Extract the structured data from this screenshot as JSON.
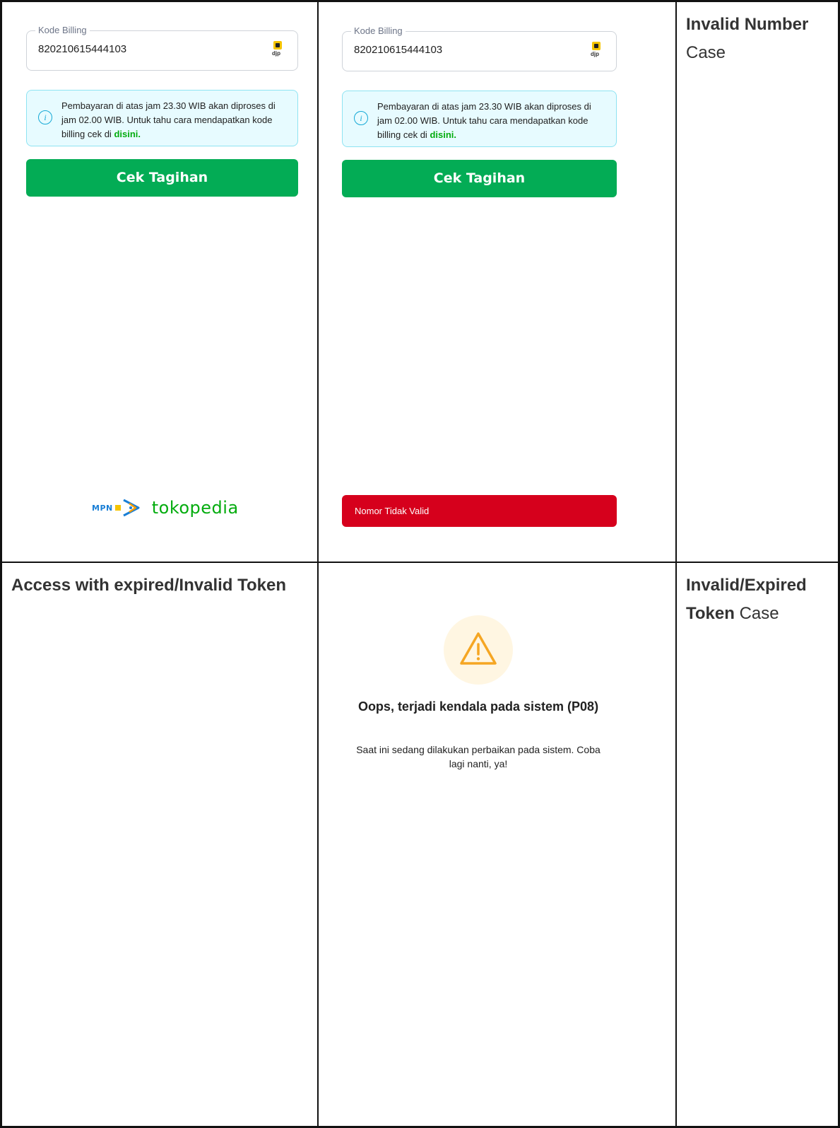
{
  "row1": {
    "screen_a": {
      "field_label": "Kode Billing",
      "field_value": "820210615444103",
      "djp_label": "djp",
      "info_text": "Pembayaran di atas jam 23.30 WIB akan diproses di jam 02.00 WIB. Untuk tahu cara mendapatkan kode billing cek di",
      "info_link": "disini",
      "info_period": ".",
      "button_label": "Cek Tagihan",
      "logo_mpn": "MPN",
      "logo_tokopedia": "tokopedia"
    },
    "screen_b": {
      "field_label": "Kode Billing",
      "field_value": "820210615444103",
      "djp_label": "djp",
      "info_text": "Pembayaran di atas jam 23.30 WIB akan diproses di jam 02.00 WIB. Untuk tahu cara mendapatkan kode billing cek di",
      "info_link": "disini",
      "info_period": ".",
      "button_label": "Cek Tagihan",
      "toast": "Nomor Tidak Valid"
    },
    "case_bold": "Invalid Number",
    "case_normal": "Case"
  },
  "row2": {
    "scenario": "Access with expired/Invalid Token",
    "error_title": "Oops, terjadi kendala pada sistem (P08)",
    "error_desc": "Saat ini sedang dilakukan perbaikan pada sistem. Coba lagi nanti, ya!",
    "case_bold": "Invalid/Expired Token",
    "case_normal": "Case"
  },
  "colors": {
    "primary_green": "#03ac55",
    "error_red": "#d6001c",
    "warning_orange": "#f5a623",
    "info_bg": "#e7fbff"
  }
}
